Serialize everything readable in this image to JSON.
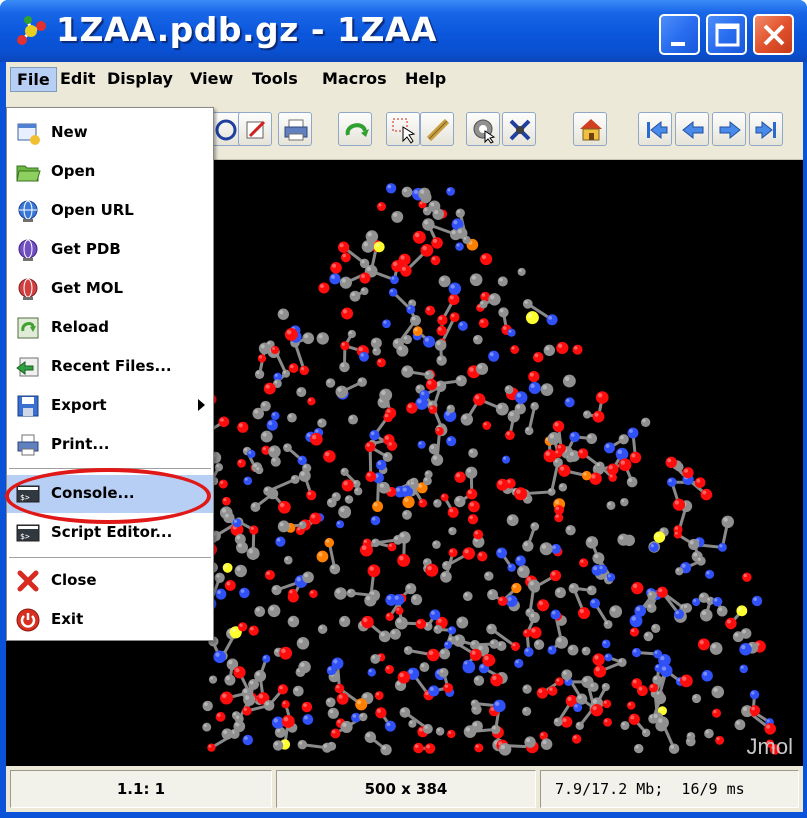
{
  "window": {
    "title": "1ZAA.pdb.gz - 1ZAA",
    "app_icon": "jmol-molecule-icon",
    "controls": [
      "minimize-icon",
      "maximize-icon",
      "close-icon"
    ]
  },
  "menubar": {
    "items": [
      {
        "label": "File",
        "active": true
      },
      {
        "label": "Edit"
      },
      {
        "label": "Display"
      },
      {
        "label": "View"
      },
      {
        "label": "Tools"
      },
      {
        "label": "Macros"
      },
      {
        "label": "Help"
      }
    ]
  },
  "file_menu": {
    "items": [
      {
        "label": "New",
        "icon": "new-file-icon"
      },
      {
        "label": "Open",
        "icon": "open-folder-icon"
      },
      {
        "label": "Open URL",
        "icon": "globe-icon"
      },
      {
        "label": "Get PDB",
        "icon": "pdb-globe-icon"
      },
      {
        "label": "Get MOL",
        "icon": "mol-globe-icon"
      },
      {
        "label": "Reload",
        "icon": "reload-icon"
      },
      {
        "label": "Recent Files...",
        "icon": "recent-files-icon"
      },
      {
        "label": "Export",
        "icon": "export-icon",
        "submenu": true
      },
      {
        "label": "Print...",
        "icon": "printer-icon"
      },
      {
        "label": "Console...",
        "icon": "console-icon",
        "highlighted": true
      },
      {
        "label": "Script Editor...",
        "icon": "script-editor-icon"
      },
      {
        "label": "Close",
        "icon": "close-x-icon"
      },
      {
        "label": "Exit",
        "icon": "power-icon"
      }
    ]
  },
  "toolbar": {
    "buttons": [
      "script-icon",
      "edit-icon",
      "print-icon",
      "rotate-icon",
      "pick-icon",
      "ruler-icon",
      "spin-icon",
      "measure-icon",
      "home-icon",
      "first-frame-icon",
      "prev-frame-icon",
      "next-frame-icon",
      "last-frame-icon"
    ]
  },
  "viewer": {
    "watermark": "Jmol"
  },
  "statusbar": {
    "frame": "1.1: 1",
    "size": "500 x 384",
    "memory": "7.9/17.2 Mb;  16/9 ms"
  },
  "colors": {
    "titlebar": "#0b57dc",
    "menu_highlight": "#b8cff5",
    "annotation": "#e01818",
    "atom_carbon": "#909090",
    "atom_oxygen": "#ff0d0d",
    "atom_nitrogen": "#3050f8",
    "atom_sulfur": "#ffff30",
    "atom_phosphorus": "#ff8000"
  }
}
